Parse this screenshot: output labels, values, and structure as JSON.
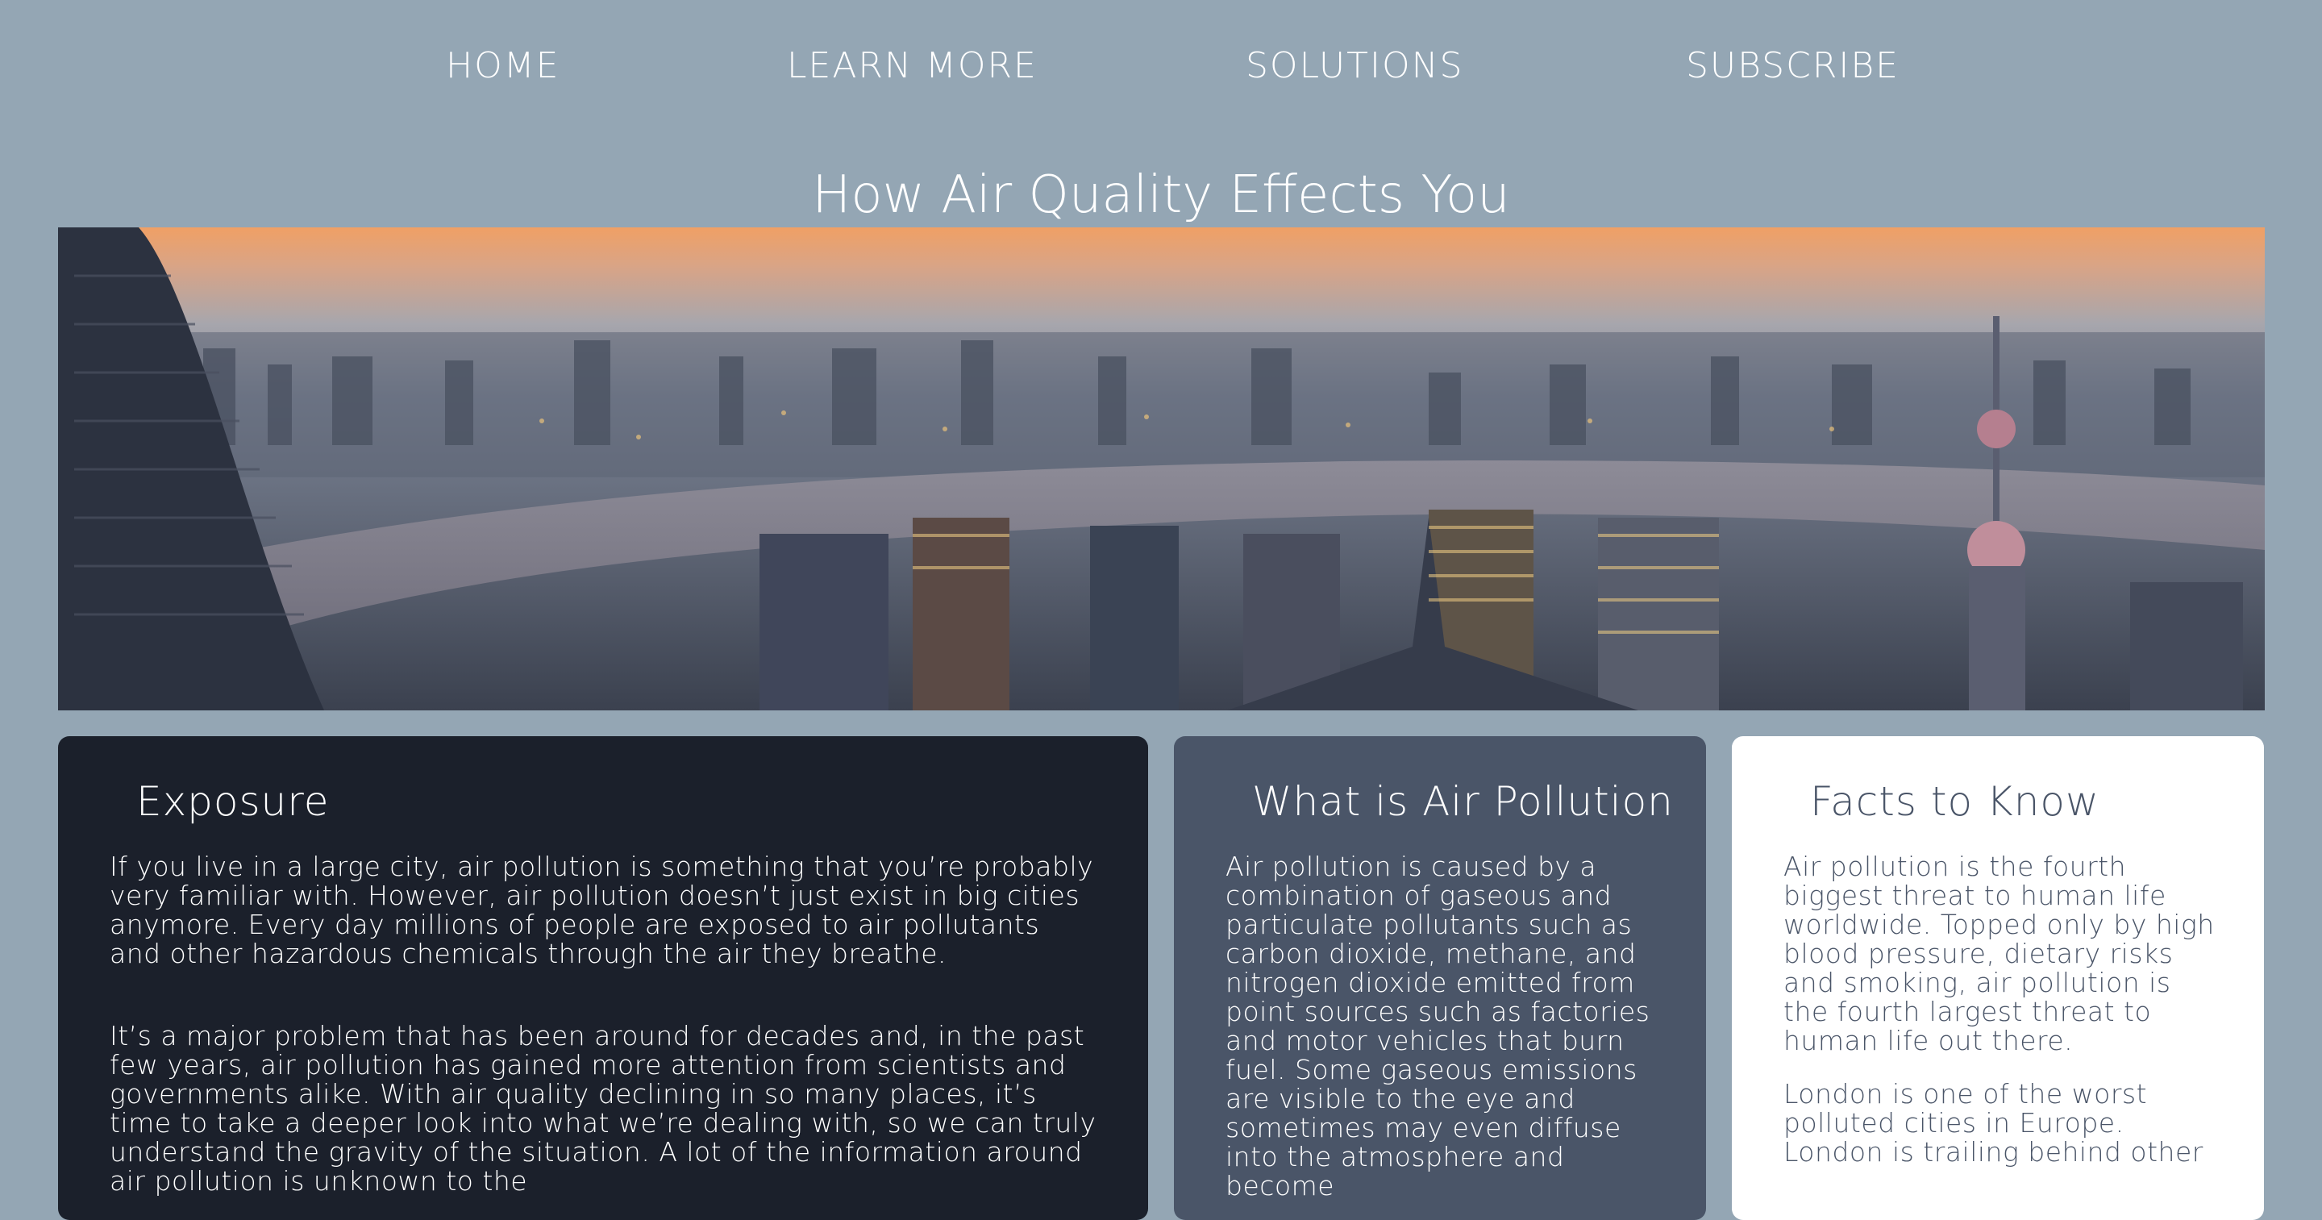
{
  "nav": {
    "items": [
      {
        "label": "HOME"
      },
      {
        "label": "LEARN MORE"
      },
      {
        "label": "SOLUTIONS"
      },
      {
        "label": "SUBSCRIBE"
      }
    ]
  },
  "hero": {
    "title": "How Air Quality Effects You"
  },
  "cards": {
    "exposure": {
      "title": "Exposure",
      "paragraphs": [
        "If you live in a large city, air pollution is something that you’re probably very familiar with. However, air pollution doesn’t just exist in big cities anymore. Every day millions of people are exposed to air pollutants and other hazardous chemicals through the air they breathe.",
        "It’s a major problem that has been around for decades and, in the past few years, air pollution has gained more attention from scientists and governments alike. With air quality declining in so many places, it’s time to take a deeper look into what we’re dealing with, so we can truly understand the gravity of the situation. A lot of the information around air pollution is unknown to the"
      ]
    },
    "what": {
      "title": "What is Air Pollution",
      "paragraphs": [
        "Air pollution is caused by a combination of gaseous and particulate pollutants such as carbon dioxide, methane, and nitrogen dioxide emitted from point sources such as factories and motor vehicles that burn fuel. Some gaseous emissions are visible to the eye and sometimes may even diffuse into the atmosphere and become"
      ]
    },
    "facts": {
      "title": "Facts to Know",
      "paragraphs": [
        "Air pollution is the fourth biggest threat to human life worldwide. Topped only by high blood pressure, dietary risks and smoking, air pollution is the fourth largest threat to human life out there.",
        "London is one of the worst polluted cities in Europe. London is trailing behind other"
      ]
    }
  },
  "colors": {
    "page_background": "#94a6b4",
    "card_dark": "#1b202b",
    "card_mid": "#4a5568",
    "card_light": "#ffffff",
    "text_light": "#ffffff",
    "text_dark": "#4a5568"
  }
}
